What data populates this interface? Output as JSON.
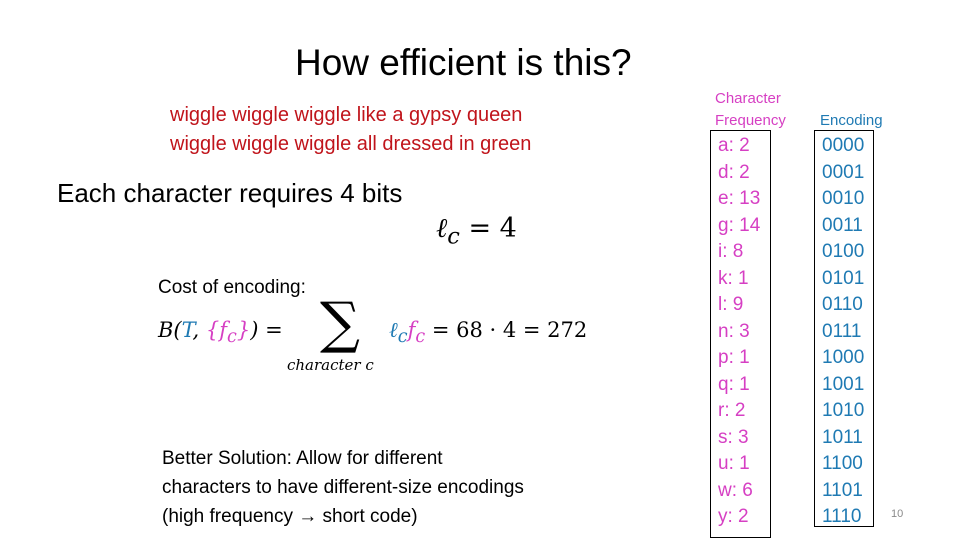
{
  "title": "How efficient is this?",
  "lyrics": [
    "wiggle wiggle wiggle like a gypsy queen",
    "wiggle wiggle wiggle all dressed in green"
  ],
  "statement": "Each character requires 4 bits",
  "length_eq": {
    "symbol": "ℓ",
    "subscript": "c",
    "rhs": "= 4"
  },
  "cost": {
    "label": "Cost of encoding:",
    "lhs_B": "B(",
    "lhs_T": "T",
    "lhs_comma": ", ",
    "lhs_f": "{f",
    "lhs_f_sub": "c",
    "lhs_f_close": "}",
    "lhs_close": ") =",
    "sum_symbol": "∑",
    "sum_subscript": "character c",
    "term_l": "ℓ",
    "term_l_sub": "c",
    "term_f": "f",
    "term_f_sub": "c",
    "result": "= 68 · 4 = 272"
  },
  "better_solution": [
    "Better Solution: Allow for different",
    "characters to have different-size encodings",
    "(high frequency → short code)"
  ],
  "table": {
    "freq_header": [
      "Character",
      "Frequency"
    ],
    "enc_header": "Encoding",
    "rows": [
      {
        "char": "a: 2",
        "code": "0000"
      },
      {
        "char": "d: 2",
        "code": "0001"
      },
      {
        "char": "e: 13",
        "code": "0010"
      },
      {
        "char": "g: 14",
        "code": "0011"
      },
      {
        "char": "i: 8",
        "code": "0100"
      },
      {
        "char": "k: 1",
        "code": "0101"
      },
      {
        "char": "l: 9",
        "code": "0110"
      },
      {
        "char": "n: 3",
        "code": "0111"
      },
      {
        "char": "p: 1",
        "code": "1000"
      },
      {
        "char": "q: 1",
        "code": "1001"
      },
      {
        "char": "r: 2",
        "code": "1010"
      },
      {
        "char": "s: 3",
        "code": "1011"
      },
      {
        "char": "u: 1",
        "code": "1100"
      },
      {
        "char": "w: 6",
        "code": "1101"
      },
      {
        "char": "y: 2",
        "code": "1110"
      }
    ]
  },
  "colors": {
    "lyrics": "#c0141b",
    "frequency": "#d63fc3",
    "encoding": "#1f7ab3"
  },
  "page_number": "10"
}
